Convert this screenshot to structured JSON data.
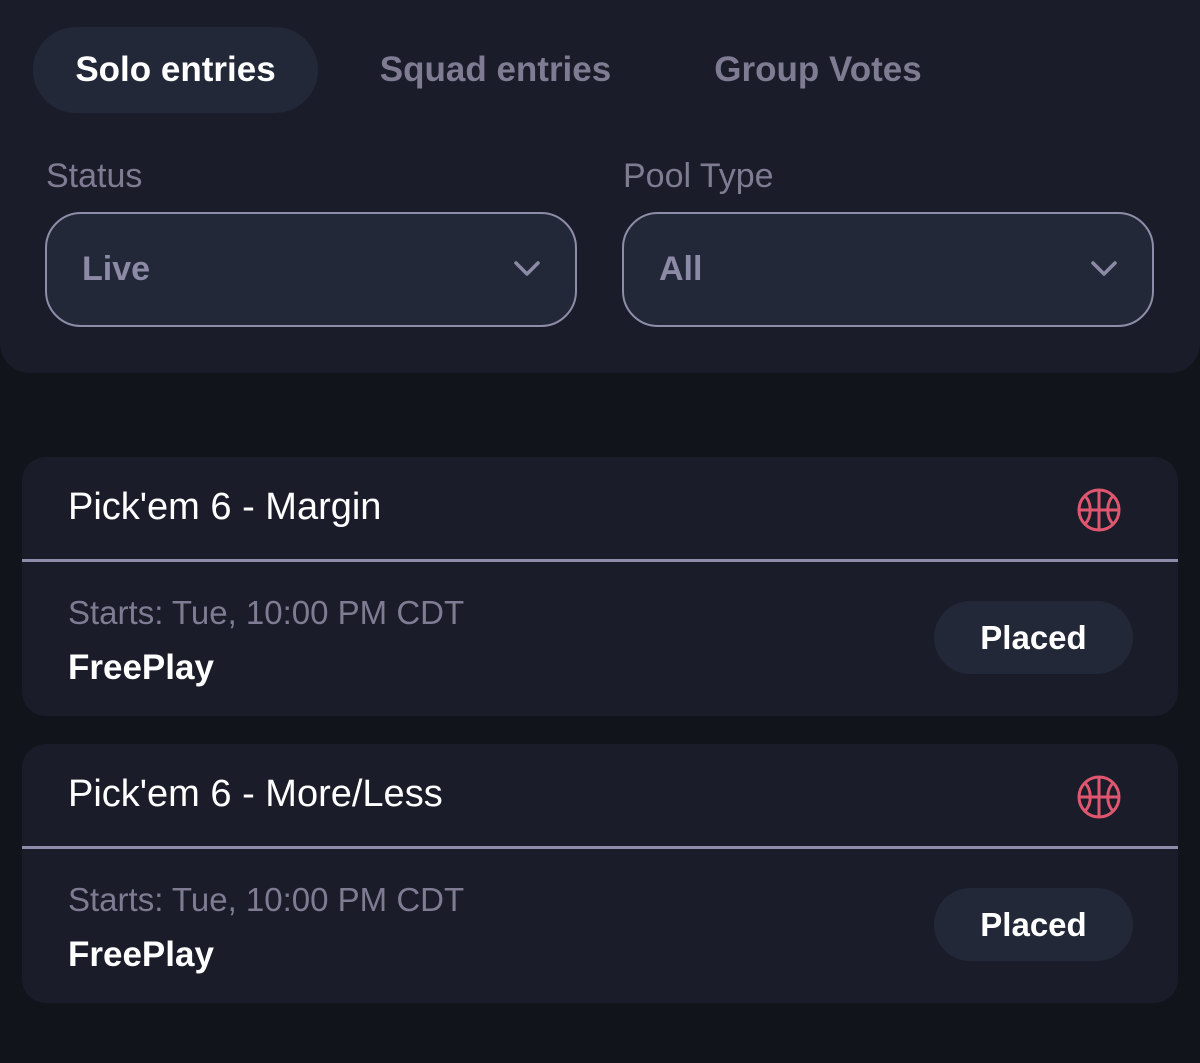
{
  "tabs": [
    {
      "label": "Solo entries",
      "active": true
    },
    {
      "label": "Squad entries",
      "active": false
    },
    {
      "label": "Group Votes",
      "active": false
    }
  ],
  "filters": {
    "status": {
      "label": "Status",
      "value": "Live"
    },
    "pool_type": {
      "label": "Pool Type",
      "value": "All"
    }
  },
  "entries": [
    {
      "title": "Pick'em 6 - Margin",
      "sport_icon": "basketball-icon",
      "starts": "Starts: Tue, 10:00 PM CDT",
      "entry_type": "FreePlay",
      "status": "Placed"
    },
    {
      "title": "Pick'em 6 - More/Less",
      "sport_icon": "basketball-icon",
      "starts": "Starts: Tue, 10:00 PM CDT",
      "entry_type": "FreePlay",
      "status": "Placed"
    }
  ],
  "colors": {
    "background": "#12141b",
    "panel": "#1a1d29",
    "pill": "#232838",
    "muted_text": "#7e7b93",
    "border": "#8e8ca8",
    "sport_icon": "#e0566f"
  }
}
